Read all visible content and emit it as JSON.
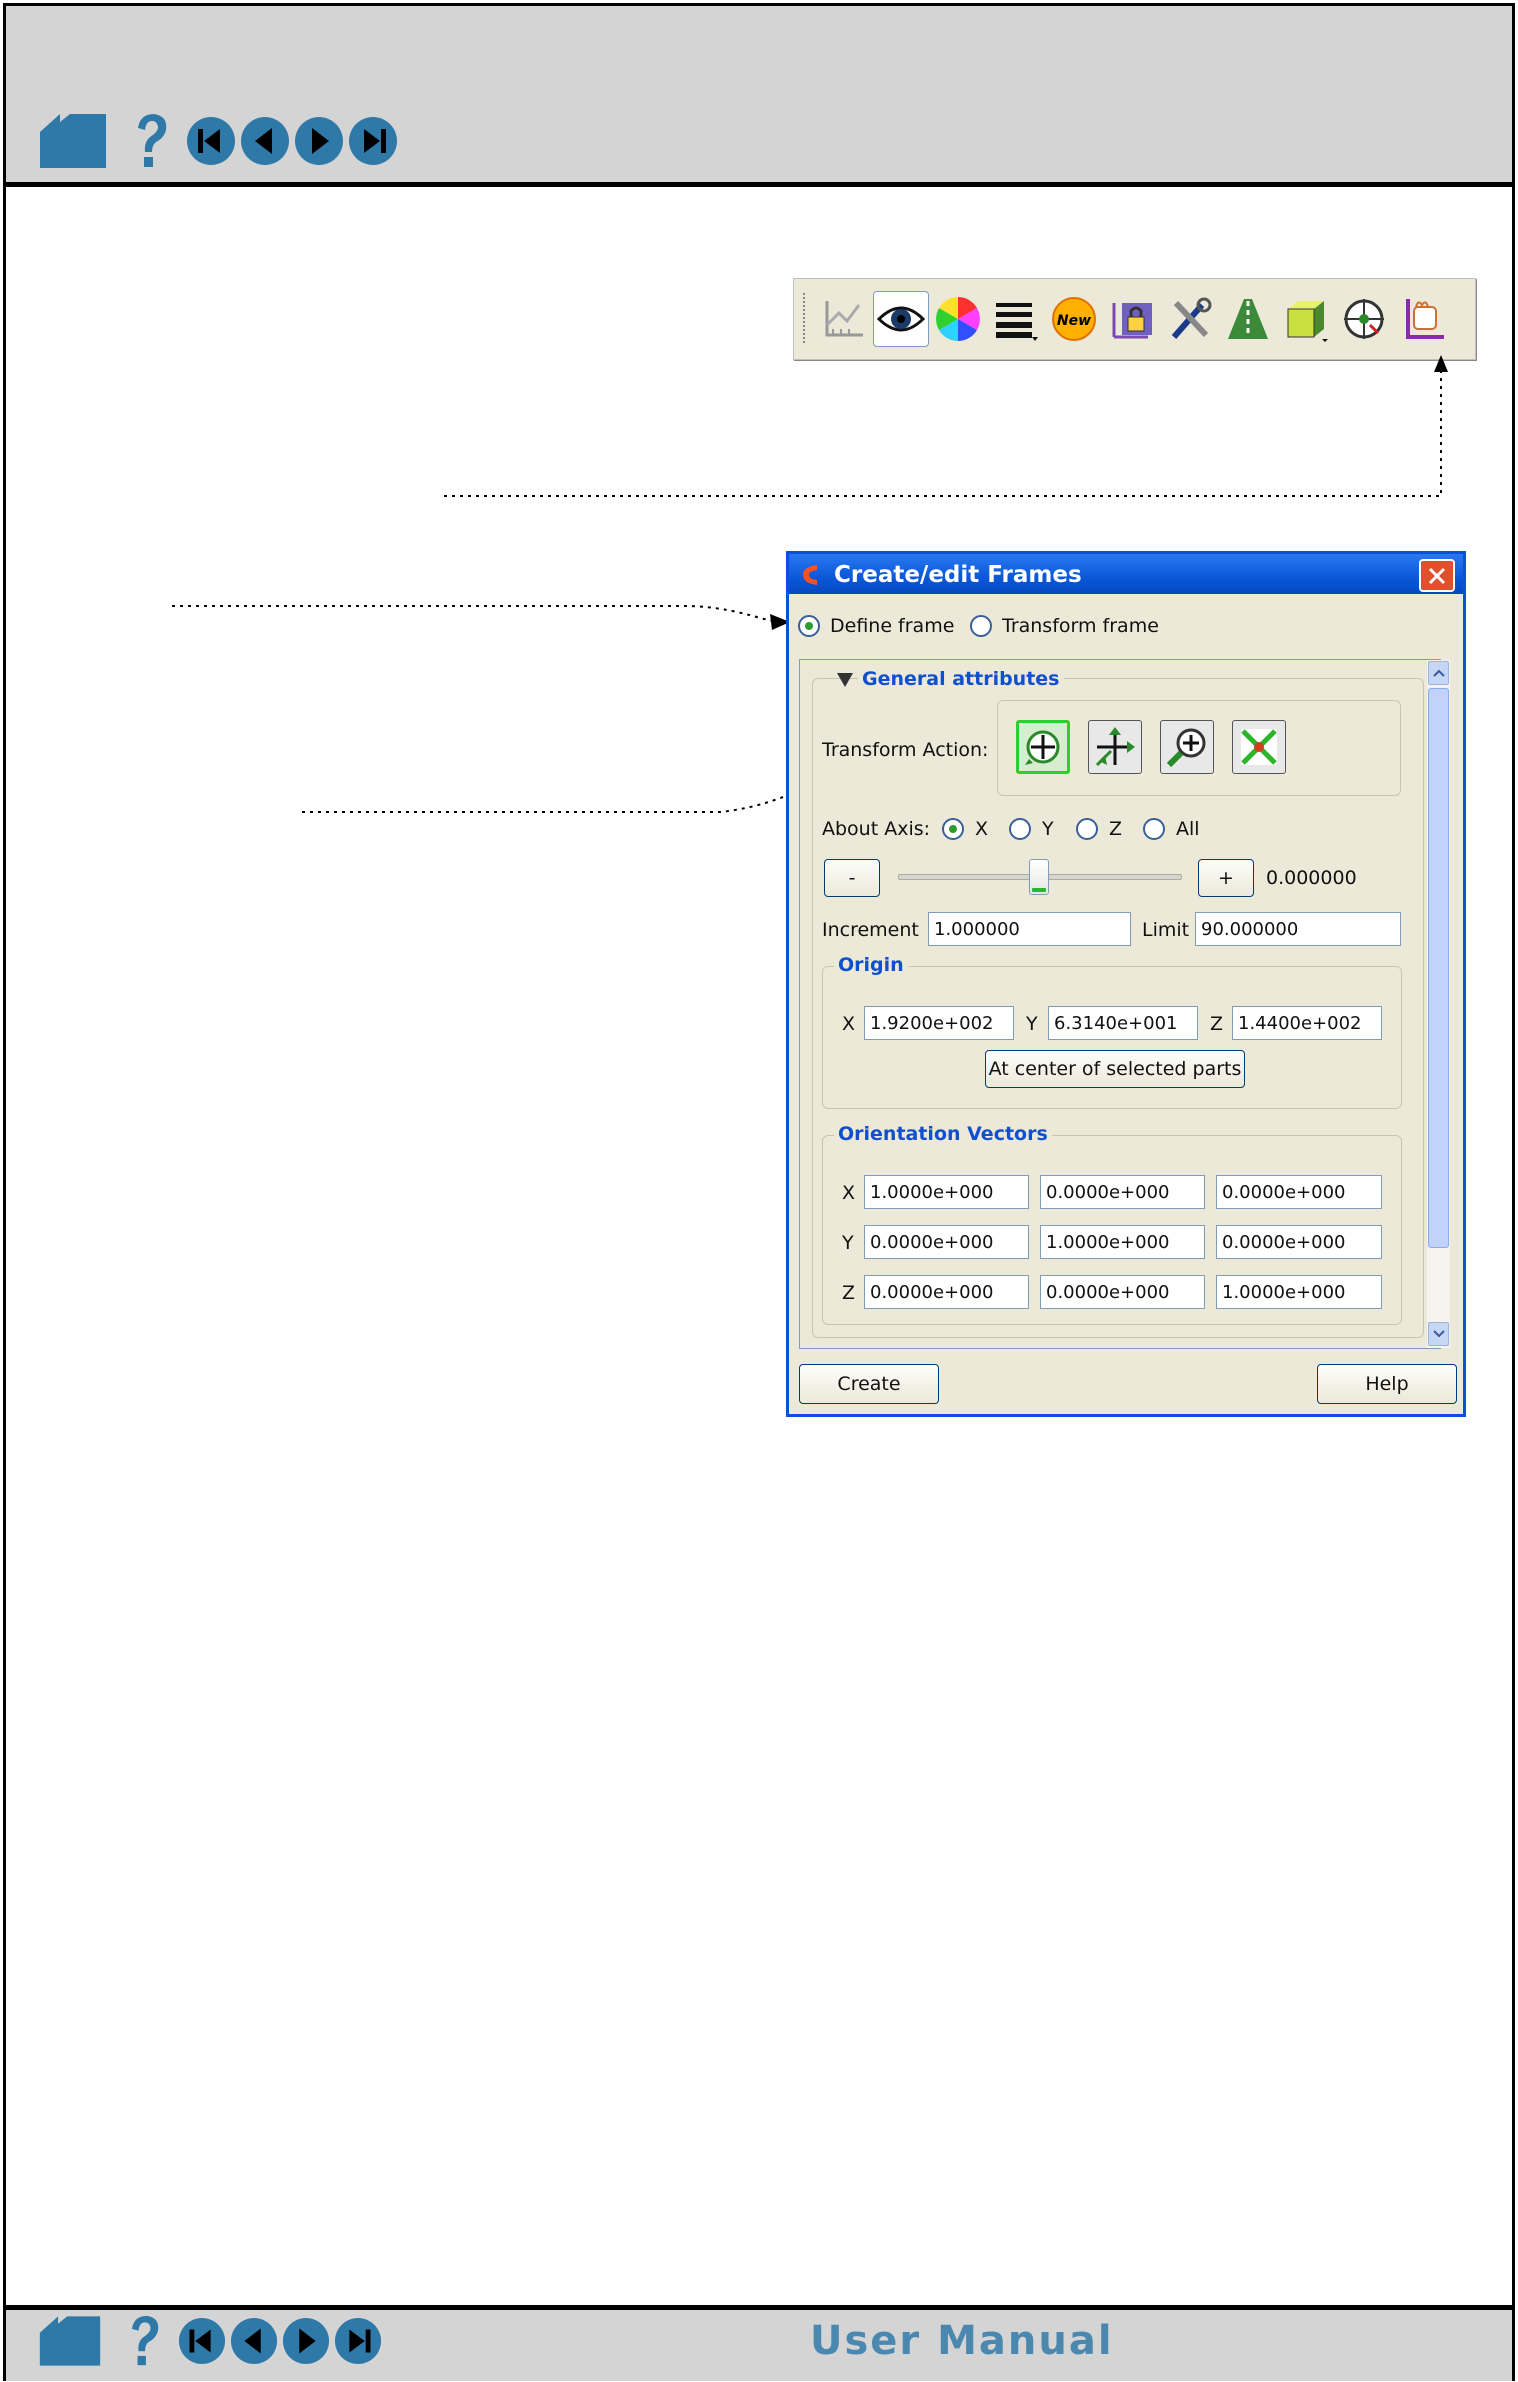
{
  "navigation": {
    "home_icon": "home-icon",
    "help_icon": "question-icon",
    "first_icon": "first-page-icon",
    "prev_icon": "previous-page-icon",
    "next_icon": "next-page-icon",
    "last_icon": "last-page-icon"
  },
  "footer": {
    "title": "User Manual"
  },
  "toolbar": {
    "icons": [
      "axis-plot-icon",
      "eye-icon",
      "color-wheel-icon",
      "line-style-icon",
      "new-icon",
      "lock-frame-icon",
      "tools-icon",
      "road-icon",
      "box-icon",
      "compass-icon",
      "frame-icon"
    ]
  },
  "dialog": {
    "title": "Create/edit Frames",
    "mode_define": "Define frame",
    "mode_transform": "Transform frame",
    "general_attributes": "General attributes",
    "transform_action_label": "Transform Action:",
    "about_axis_label": "About Axis:",
    "axis_x": "X",
    "axis_y": "Y",
    "axis_z": "Z",
    "axis_all": "All",
    "minus_label": "-",
    "plus_label": "+",
    "slider_value": "0.000000",
    "slider_position": 0.5,
    "increment_label": "Increment",
    "increment_value": "1.000000",
    "limit_label": "Limit",
    "limit_value": "90.000000",
    "origin": {
      "label": "Origin",
      "x_label": "X",
      "x_value": "1.9200e+002",
      "y_label": "Y",
      "y_value": "6.3140e+001",
      "z_label": "Z",
      "z_value": "1.4400e+002",
      "center_button": "At center of selected parts"
    },
    "orientation": {
      "label": "Orientation Vectors",
      "rows": [
        {
          "label": "X",
          "values": [
            "1.0000e+000",
            "0.0000e+000",
            "0.0000e+000"
          ]
        },
        {
          "label": "Y",
          "values": [
            "0.0000e+000",
            "1.0000e+000",
            "0.0000e+000"
          ]
        },
        {
          "label": "Z",
          "values": [
            "0.0000e+000",
            "0.0000e+000",
            "1.0000e+000"
          ]
        }
      ]
    },
    "create_button": "Create",
    "help_button": "Help"
  },
  "colors": {
    "nav_blue": "#2f79a8",
    "title_blue": "#0a58d8",
    "group_label": "#1050d0"
  }
}
